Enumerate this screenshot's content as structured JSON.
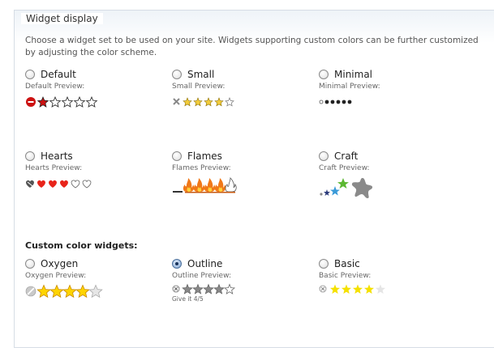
{
  "fieldset": {
    "legend": "Widget display",
    "description": "Choose a widget set to be used on your site. Widgets supporting custom colors can be further customized by adjusting the color scheme."
  },
  "widgets": [
    {
      "id": "default",
      "label": "Default",
      "preview_label": "Default Preview:",
      "selected": false
    },
    {
      "id": "small",
      "label": "Small",
      "preview_label": "Small Preview:",
      "selected": false
    },
    {
      "id": "minimal",
      "label": "Minimal",
      "preview_label": "Minimal Preview:",
      "selected": false
    },
    {
      "id": "hearts",
      "label": "Hearts",
      "preview_label": "Hearts Preview:",
      "selected": false
    },
    {
      "id": "flames",
      "label": "Flames",
      "preview_label": "Flames Preview:",
      "selected": false
    },
    {
      "id": "craft",
      "label": "Craft",
      "preview_label": "Craft Preview:",
      "selected": false
    }
  ],
  "custom": {
    "title": "Custom color widgets:",
    "widgets": [
      {
        "id": "oxygen",
        "label": "Oxygen",
        "preview_label": "Oxygen Preview:",
        "selected": false
      },
      {
        "id": "outline",
        "label": "Outline",
        "preview_label": "Outline Preview:",
        "selected": true,
        "caption": "Give it 4/5"
      },
      {
        "id": "basic",
        "label": "Basic",
        "preview_label": "Basic Preview:",
        "selected": false
      }
    ]
  },
  "colors": {
    "star_gold": "#f5c800",
    "star_red": "#cc1111",
    "heart_red": "#e8241a",
    "selected_radio": "#4a6f9c",
    "border": "#d6dde5"
  }
}
